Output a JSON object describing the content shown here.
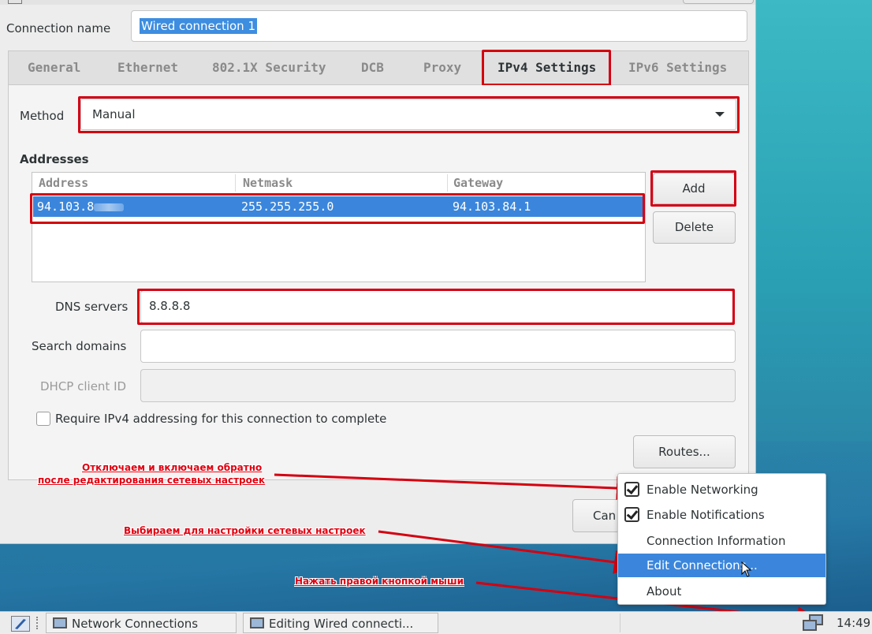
{
  "dialog": {
    "connection_name_label": "Connection name",
    "connection_name_value": "Wired connection 1",
    "tabs": [
      {
        "label": "General"
      },
      {
        "label": "Ethernet"
      },
      {
        "label": "802.1X Security"
      },
      {
        "label": "DCB"
      },
      {
        "label": "Proxy"
      },
      {
        "label": "IPv4 Settings",
        "active": true
      },
      {
        "label": "IPv6 Settings"
      }
    ],
    "method_label": "Method",
    "method_value": "Manual",
    "addresses_heading": "Addresses",
    "addresses_columns": [
      "Address",
      "Netmask",
      "Gateway"
    ],
    "addresses_rows": [
      {
        "address": "94.103.8",
        "netmask": "255.255.255.0",
        "gateway": "94.103.84.1"
      }
    ],
    "add_button": "Add",
    "delete_button": "Delete",
    "dns_label": "DNS servers",
    "dns_value": "8.8.8.8",
    "search_domains_label": "Search domains",
    "search_domains_value": "",
    "dhcp_client_id_label": "DHCP client ID",
    "dhcp_client_id_value": "",
    "require_ipv4_label": "Require IPv4 addressing for this connection to complete",
    "routes_button": "Routes...",
    "cancel_button_partial": "Can"
  },
  "annotations": {
    "networking_line1": "Отключаем и включаем обратно",
    "networking_line2": "после редактирования сетевых настроек",
    "edit_connections": "Выбираем для настройки сетевых настроек",
    "right_click": "Нажать правой кнопкой мыши"
  },
  "tray_menu": {
    "items": [
      {
        "label": "Enable Networking",
        "checked": true
      },
      {
        "label": "Enable Notifications",
        "checked": true
      },
      {
        "label": "Connection Information",
        "checked": false
      },
      {
        "label": "Edit Connections...",
        "checked": false,
        "highlighted": true
      },
      {
        "label": "About",
        "checked": false
      }
    ]
  },
  "taskbar": {
    "tasks": [
      {
        "label": "Network Connections"
      },
      {
        "label": "Editing Wired connecti..."
      }
    ],
    "clock": "14:49"
  },
  "colors": {
    "accent": "#3b86dc",
    "annotation": "#d40010"
  }
}
